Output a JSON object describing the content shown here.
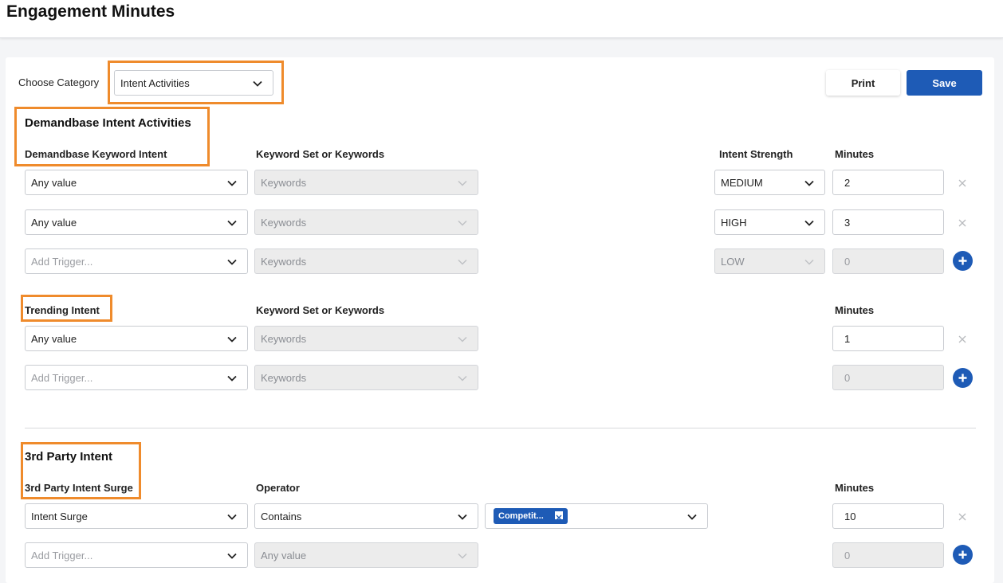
{
  "header": {
    "title": "Engagement Minutes"
  },
  "toolbar": {
    "category_label": "Choose Category",
    "category_value": "Intent Activities",
    "print_label": "Print",
    "save_label": "Save"
  },
  "demandbase": {
    "title": "Demandbase Intent Activities",
    "col_trigger": "Demandbase Keyword Intent",
    "col_keywords": "Keyword Set or Keywords",
    "col_strength": "Intent Strength",
    "col_minutes": "Minutes",
    "rows": [
      {
        "trigger": "Any value",
        "keywords": "Keywords",
        "strength": "MEDIUM",
        "minutes": "2"
      },
      {
        "trigger": "Any value",
        "keywords": "Keywords",
        "strength": "HIGH",
        "minutes": "3"
      },
      {
        "trigger": "Add Trigger...",
        "keywords": "Keywords",
        "strength": "LOW",
        "minutes": "0"
      }
    ]
  },
  "trending": {
    "title": "Trending Intent",
    "col_keywords": "Keyword Set or Keywords",
    "col_minutes": "Minutes",
    "rows": [
      {
        "trigger": "Any value",
        "keywords": "Keywords",
        "minutes": "1"
      },
      {
        "trigger": "Add Trigger...",
        "keywords": "Keywords",
        "minutes": "0"
      }
    ]
  },
  "third_party": {
    "title": "3rd Party Intent",
    "col_trigger": "3rd Party Intent Surge",
    "col_operator": "Operator",
    "col_minutes": "Minutes",
    "rows": [
      {
        "trigger": "Intent Surge",
        "operator": "Contains",
        "tag": "Competit...",
        "minutes": "10"
      },
      {
        "trigger": "Add Trigger...",
        "operator": "Any value",
        "minutes": "0"
      }
    ]
  },
  "colors": {
    "accent": "#1e5bb6",
    "highlight": "#ef8b2c"
  }
}
